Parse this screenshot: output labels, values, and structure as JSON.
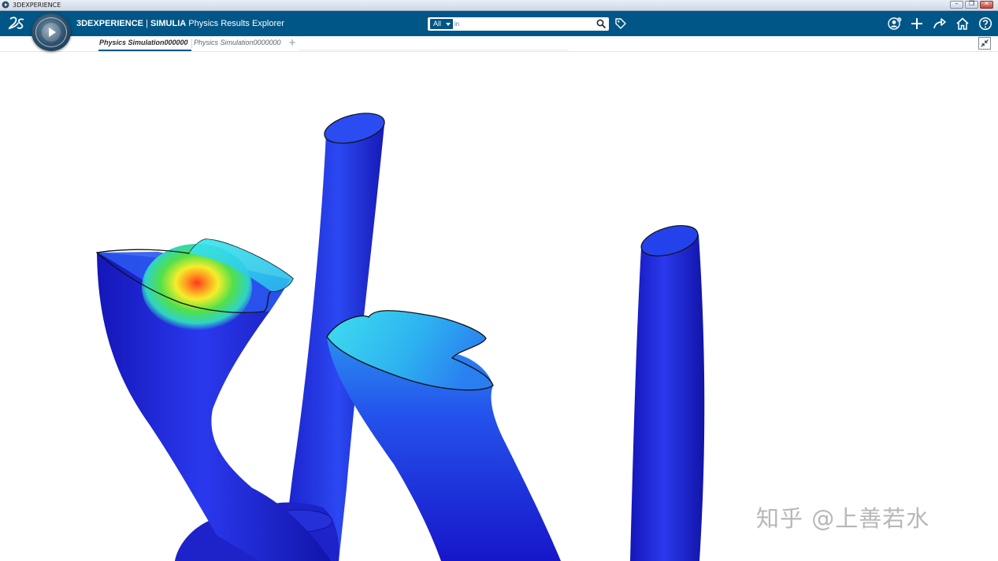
{
  "os_window": {
    "title": "3DEXPERIENCE",
    "min_label": "–",
    "max_label": "❐",
    "close_label": "✕"
  },
  "topbar": {
    "brand": "3DEXPERIENCE",
    "separator": " | ",
    "product": "SIMULIA",
    "app_name": " Physics Results Explorer",
    "search": {
      "filter_label": "All",
      "placeholder": "in"
    },
    "icons": [
      "tag-icon",
      "user-icon",
      "plus-icon",
      "share-icon",
      "home-icon",
      "help-icon"
    ]
  },
  "tabs": [
    {
      "label": "Physics Simulation000000",
      "active": true
    },
    {
      "label": "Physics Simulation0000000",
      "active": false
    }
  ],
  "tab_add_label": "+",
  "watermark": "知乎 @上善若水",
  "colors": {
    "brand_blue": "#005686",
    "result_low": "#1a1ee0",
    "result_mid": "#2fd3f0",
    "result_high": "#ff3a1a"
  }
}
